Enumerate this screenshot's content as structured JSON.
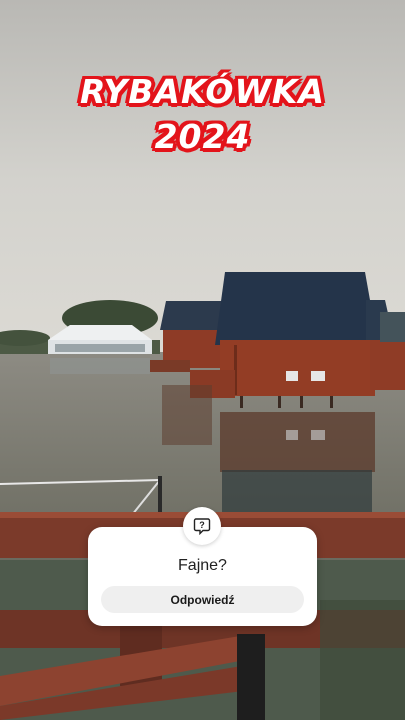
{
  "overlay": {
    "title_line1": "RYBAKÓWKA",
    "title_line2": "2024",
    "title_color": "#ffffff",
    "title_outline": "#e3141b"
  },
  "question_sticker": {
    "icon": "question-bubble-icon",
    "question": "Fajne?",
    "answer_button": "Odpowiedź"
  }
}
